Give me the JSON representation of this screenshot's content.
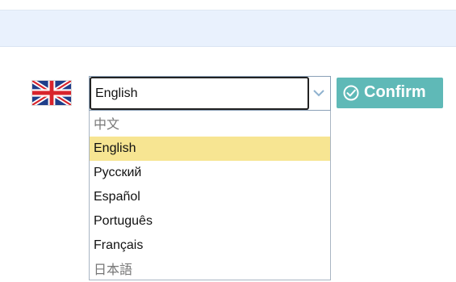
{
  "language_selector": {
    "flag_icon": "uk-flag-icon",
    "selected_value": "English",
    "options": [
      "中文",
      "English",
      "Русский",
      "Español",
      "Português",
      "Français",
      "日本語"
    ],
    "highlighted_option": "English"
  },
  "confirm_button": {
    "label": "Confirm",
    "icon": "check-circle-icon",
    "color": "#5fb9b7"
  },
  "colors": {
    "top_bar": "#e9f1fd",
    "highlight": "#f7e592"
  }
}
